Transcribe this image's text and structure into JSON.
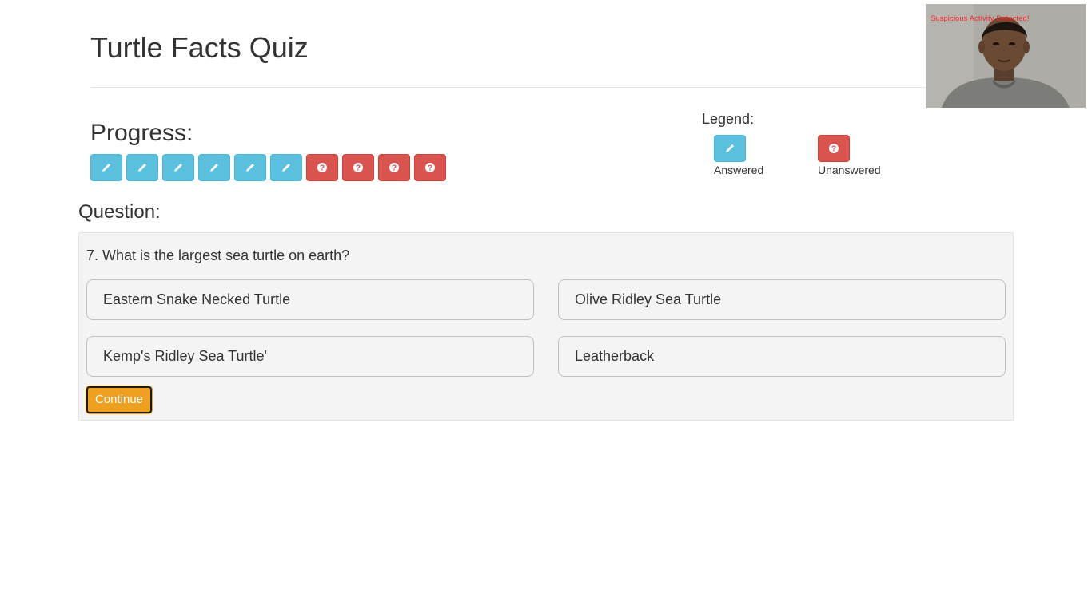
{
  "quiz": {
    "title": "Turtle Facts Quiz"
  },
  "progress": {
    "heading": "Progress:",
    "items": [
      {
        "state": "answered",
        "icon": "pencil-icon"
      },
      {
        "state": "answered",
        "icon": "pencil-icon"
      },
      {
        "state": "answered",
        "icon": "pencil-icon"
      },
      {
        "state": "answered",
        "icon": "pencil-icon"
      },
      {
        "state": "answered",
        "icon": "pencil-icon"
      },
      {
        "state": "answered",
        "icon": "pencil-icon"
      },
      {
        "state": "unanswered",
        "icon": "question-circle-icon"
      },
      {
        "state": "unanswered",
        "icon": "question-circle-icon"
      },
      {
        "state": "unanswered",
        "icon": "question-circle-icon"
      },
      {
        "state": "unanswered",
        "icon": "question-circle-icon"
      }
    ]
  },
  "legend": {
    "heading": "Legend:",
    "answered_label": "Answered",
    "unanswered_label": "Unanswered"
  },
  "question": {
    "heading": "Question:",
    "text": "7. What is the largest sea turtle on earth?",
    "options": [
      "Eastern Snake Necked Turtle",
      "Olive Ridley Sea Turtle",
      "Kemp's Ridley Sea Turtle'",
      "Leatherback"
    ],
    "continue_label": "Continue"
  },
  "webcam": {
    "alert_text": "Suspicious Activity Detected!"
  },
  "colors": {
    "answered": "#5bc0de",
    "unanswered": "#d9534f",
    "continue": "#f0a020",
    "alert": "#ff2020"
  }
}
